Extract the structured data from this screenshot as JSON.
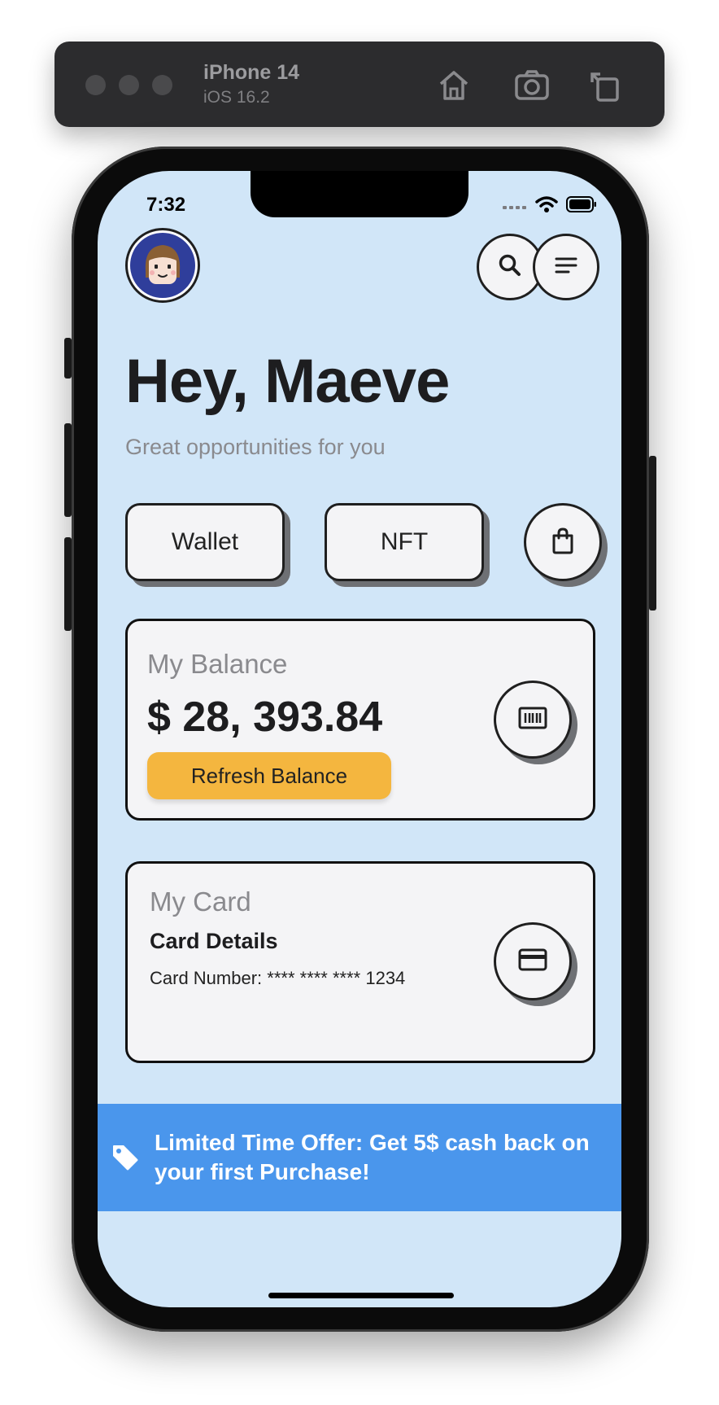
{
  "simulator": {
    "device_name": "iPhone 14",
    "os_version": "iOS 16.2",
    "toolbar_icons": [
      "home-icon",
      "screenshot-icon",
      "rotate-icon"
    ]
  },
  "status_bar": {
    "time": "7:32",
    "icons": [
      "signal-icon",
      "wifi-icon",
      "battery-icon"
    ]
  },
  "header": {
    "avatar": "avatar",
    "actions": [
      "search-icon",
      "menu-icon"
    ]
  },
  "greeting": {
    "title": "Hey, Maeve",
    "subtitle": "Great opportunities for you"
  },
  "quick_actions": {
    "wallet_label": "Wallet",
    "nft_label": "NFT",
    "bag_icon": "shopping-bag-icon"
  },
  "balance_card": {
    "label": "My Balance",
    "amount": "$ 28, 393.84",
    "refresh_label": "Refresh Balance",
    "icon": "barcode-icon"
  },
  "my_card": {
    "label": "My Card",
    "details_title": "Card Details",
    "card_number": "Card Number: **** **** **** 1234",
    "icon": "credit-card-icon"
  },
  "offer_banner": {
    "text": "Limited Time Offer: Get 5$ cash back on your first Purchase!",
    "icon": "tag-icon"
  },
  "colors": {
    "screen_background": "#d1e6f8",
    "card_background": "#f4f4f6",
    "accent_button": "#f4b63f",
    "banner": "#4a96ec",
    "text_primary": "#1d1d1f",
    "text_secondary": "#8a8a8e"
  }
}
